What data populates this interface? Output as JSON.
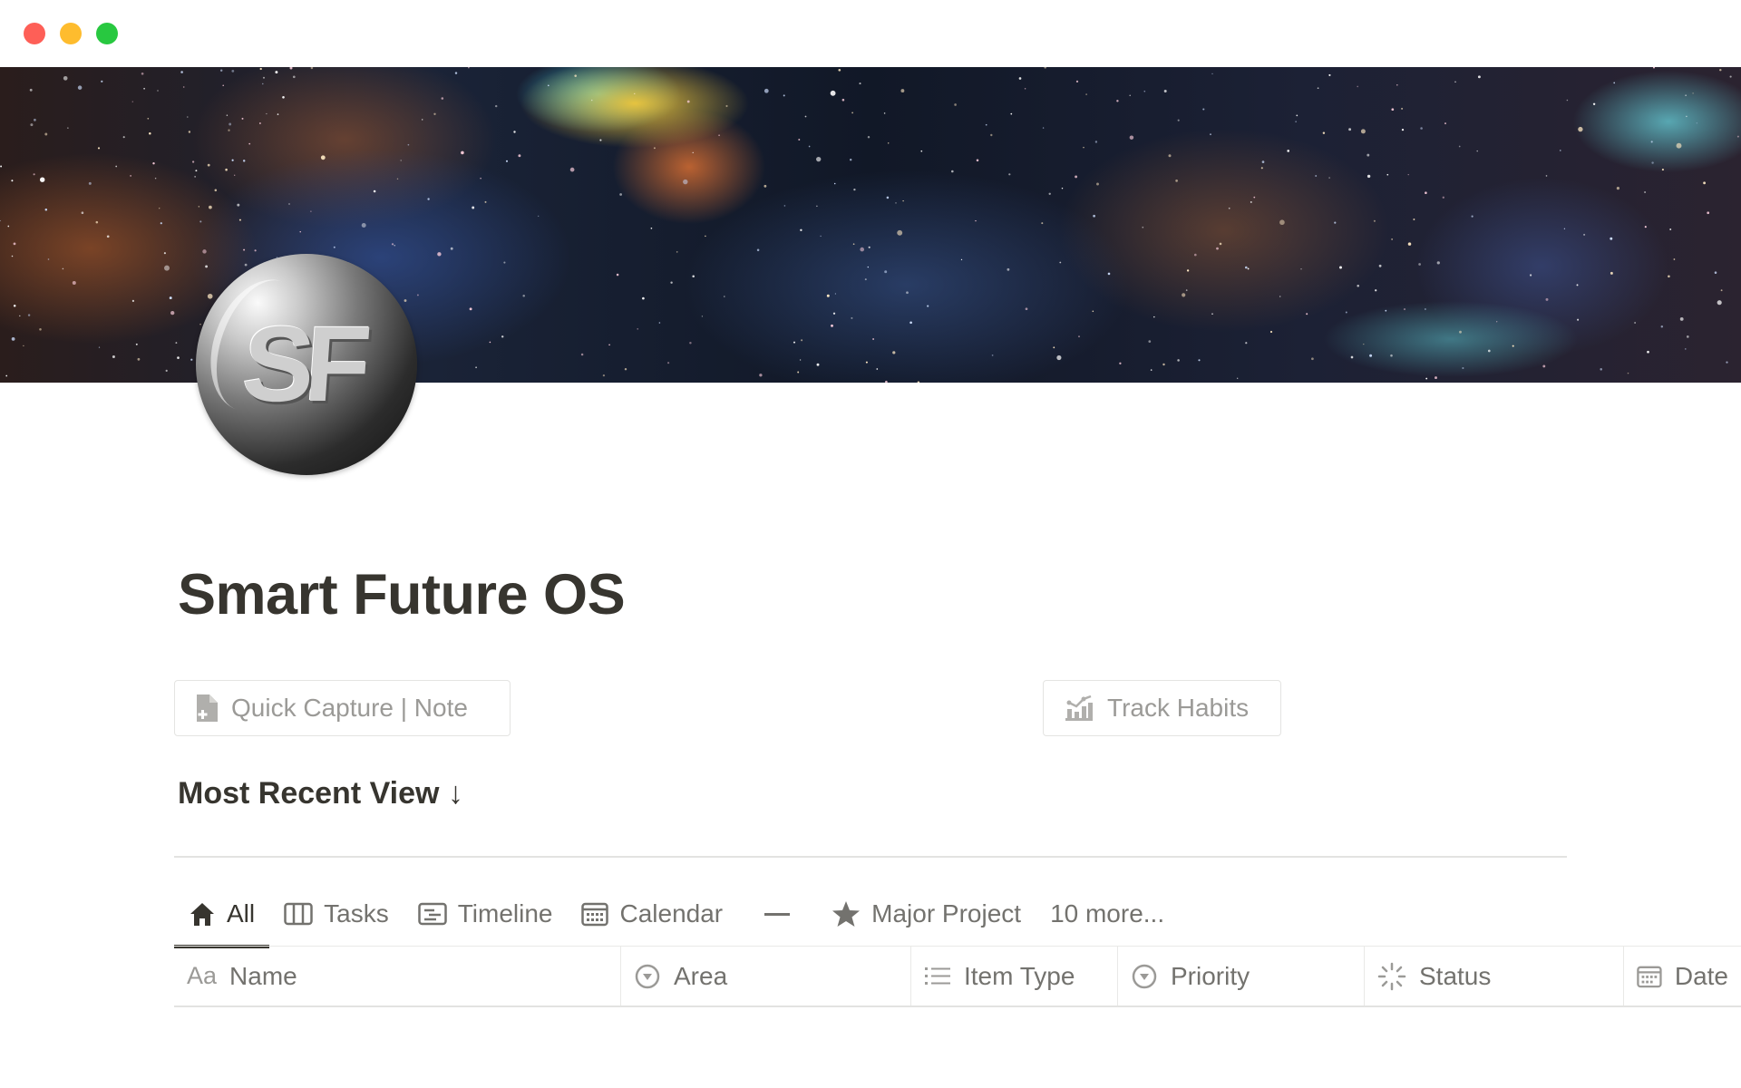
{
  "window": {
    "controls": [
      "close",
      "minimize",
      "zoom"
    ]
  },
  "cover": {
    "description_icon": "nebula-cover-image"
  },
  "avatar": {
    "logo_text": "SF"
  },
  "page": {
    "title": "Smart Future OS"
  },
  "buttons": {
    "quick_capture": {
      "label": "Quick Capture | Note",
      "icon": "document-plus-icon"
    },
    "track_habits": {
      "label": "Track Habits",
      "icon": "chart-icon"
    }
  },
  "section": {
    "title": "Most Recent View ↓"
  },
  "tabs": [
    {
      "label": "All",
      "icon": "home-icon",
      "active": true
    },
    {
      "label": "Tasks",
      "icon": "board-icon"
    },
    {
      "label": "Timeline",
      "icon": "timeline-icon"
    },
    {
      "label": "Calendar",
      "icon": "calendar-icon"
    },
    {
      "label": "",
      "icon": "dash-icon"
    },
    {
      "label": "Major Project",
      "icon": "star-icon"
    },
    {
      "label": "10 more..."
    }
  ],
  "table": {
    "columns": [
      {
        "label": "Name",
        "prefix": "Aa"
      },
      {
        "label": "Area",
        "icon": "select-icon"
      },
      {
        "label": "Item Type",
        "icon": "list-icon"
      },
      {
        "label": "Priority",
        "icon": "select-icon"
      },
      {
        "label": "Status",
        "icon": "status-icon"
      },
      {
        "label": "Date",
        "icon": "calendar-icon"
      }
    ]
  },
  "colors": {
    "text_primary": "#37352f",
    "text_secondary": "#73726e",
    "text_muted": "#9b9a97",
    "border": "#e3e3e1",
    "traffic_red": "#fe5f57",
    "traffic_yellow": "#febc2e",
    "traffic_green": "#28c840"
  }
}
